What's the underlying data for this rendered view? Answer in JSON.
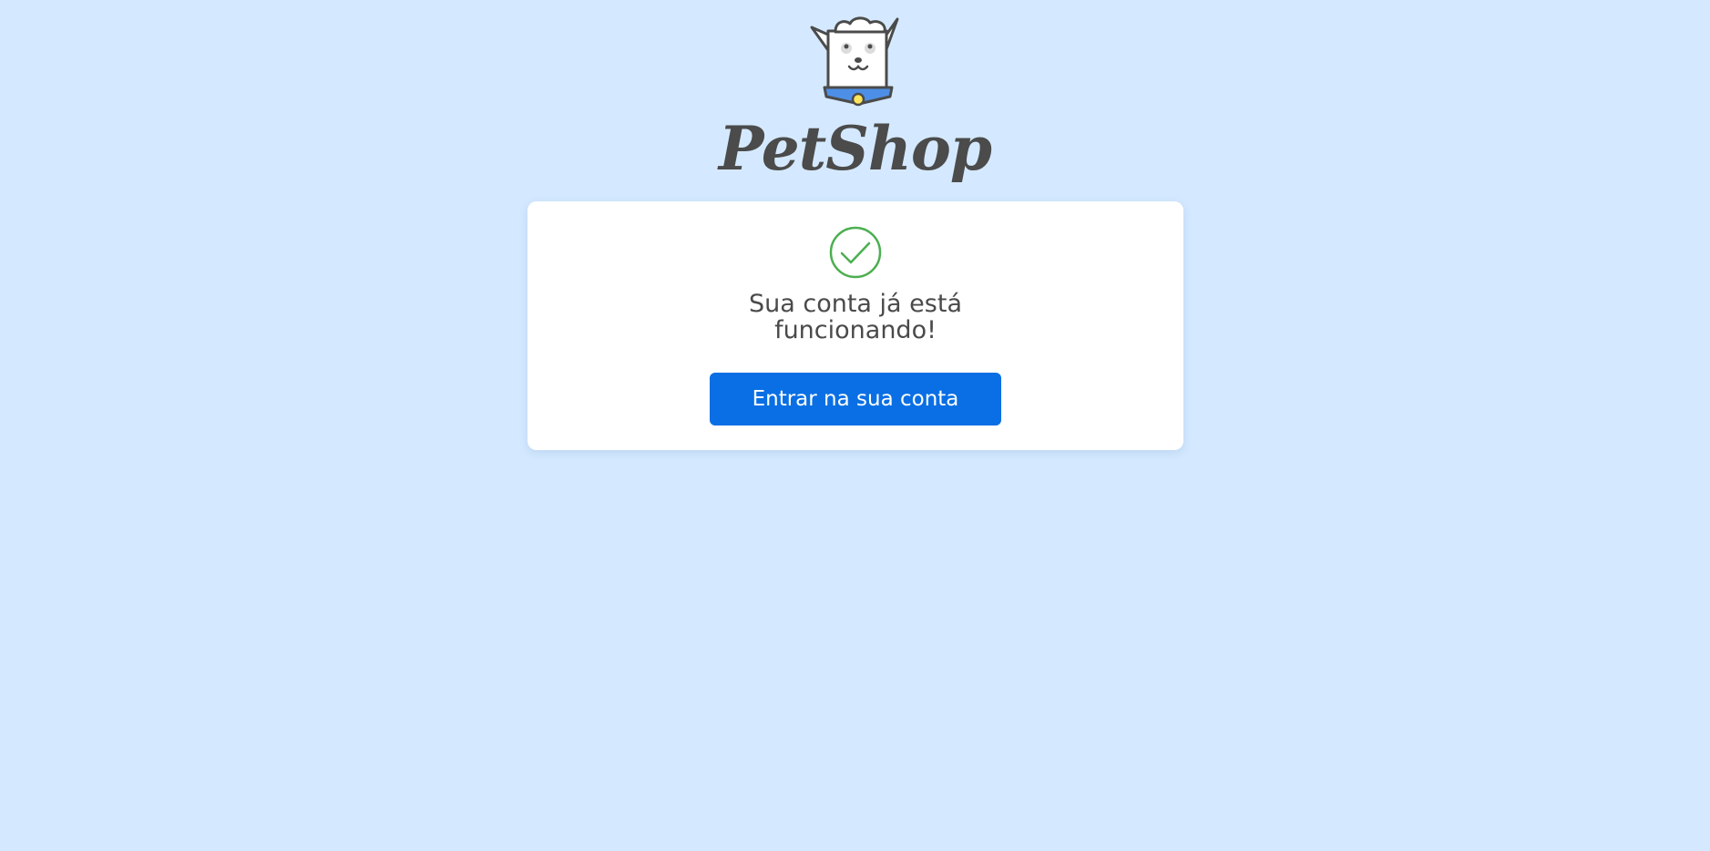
{
  "brand": {
    "name": "PetShop",
    "mascot_icon": "dog-mascot-icon",
    "text_color": "#4b4b4b",
    "collar_color": "#4d8fe6",
    "tag_color": "#ffe55a"
  },
  "confirmation": {
    "status_icon": "check-circle-icon",
    "status_color": "#4caf50",
    "message_line_1": "Sua conta já está",
    "message_line_2": "funcionando!",
    "button_label": "Entrar na sua conta",
    "button_color": "#0a6fe4"
  },
  "page": {
    "background": "#d4e9ff"
  }
}
